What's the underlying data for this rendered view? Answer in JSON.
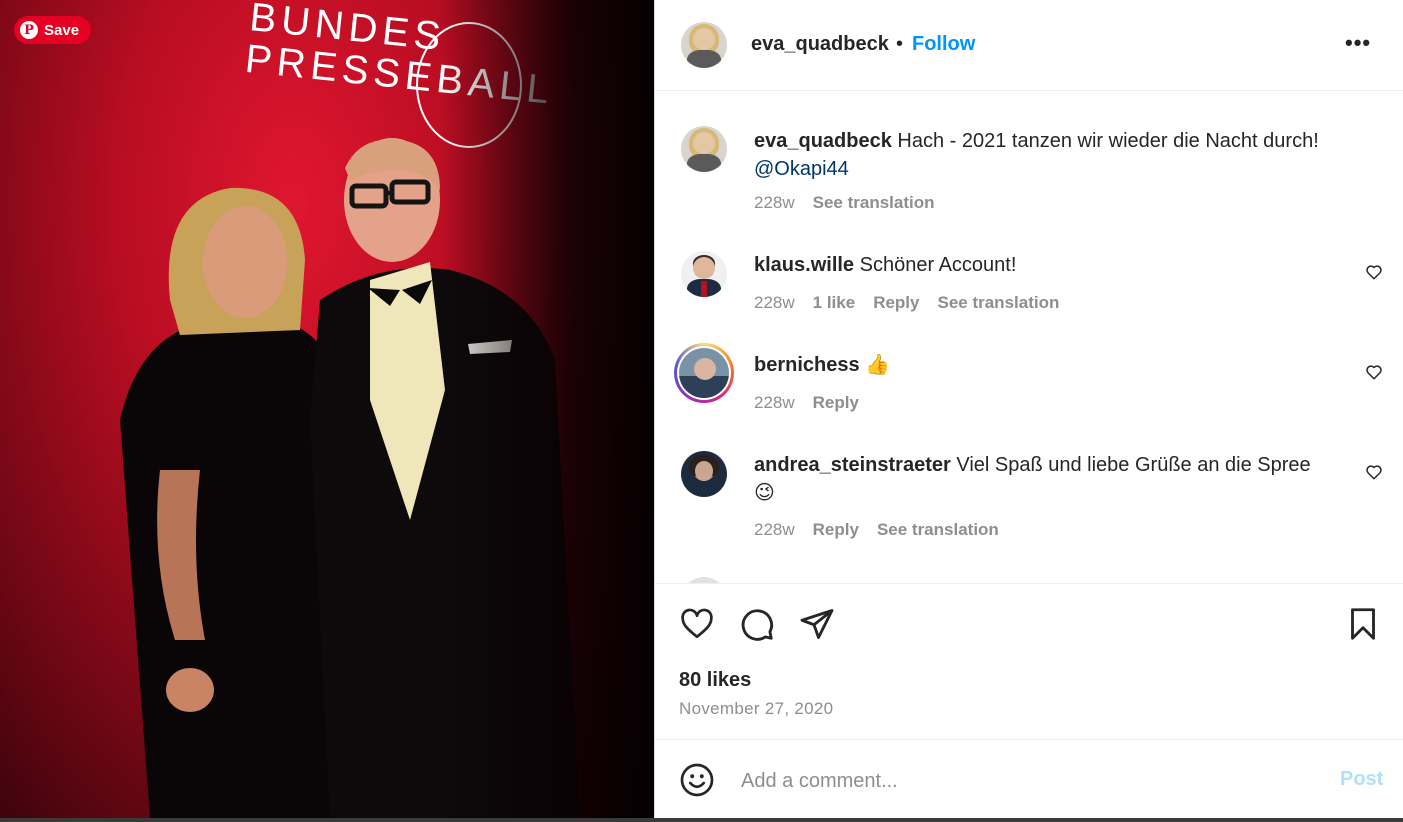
{
  "photo": {
    "save_label": "Save",
    "pinterest_glyph": "P",
    "brand_line1": "BUNDES",
    "brand_line2": "PRESSEBALL"
  },
  "header": {
    "username": "eva_quadbeck",
    "separator": "•",
    "follow_label": "Follow",
    "more_label": "•••"
  },
  "caption": {
    "username": "eva_quadbeck",
    "text": "Hach - 2021 tanzen wir wieder die Nacht durch!",
    "mention": "@Okapi44",
    "age": "228w",
    "translate": "See translation"
  },
  "comments": [
    {
      "username": "klaus.wille",
      "text": "Schöner Account!",
      "age": "228w",
      "likes": "1 like",
      "reply": "Reply",
      "translate": "See translation"
    },
    {
      "username": "bernichess",
      "text": "👍",
      "age": "228w",
      "reply": "Reply"
    },
    {
      "username": "andrea_steinstraeter",
      "text": "Viel Spaß und liebe Grüße an die Spree",
      "emoji": "😉",
      "age": "228w",
      "reply": "Reply",
      "translate": "See translation"
    }
  ],
  "stats": {
    "likes": "80 likes",
    "date": "November 27, 2020"
  },
  "composer": {
    "placeholder": "Add a comment...",
    "post_label": "Post"
  },
  "colors": {
    "accent": "#0095f6",
    "text": "#262626",
    "muted": "#8e8e8e",
    "post_disabled": "#b2dffc",
    "pinterest": "#e60023"
  }
}
